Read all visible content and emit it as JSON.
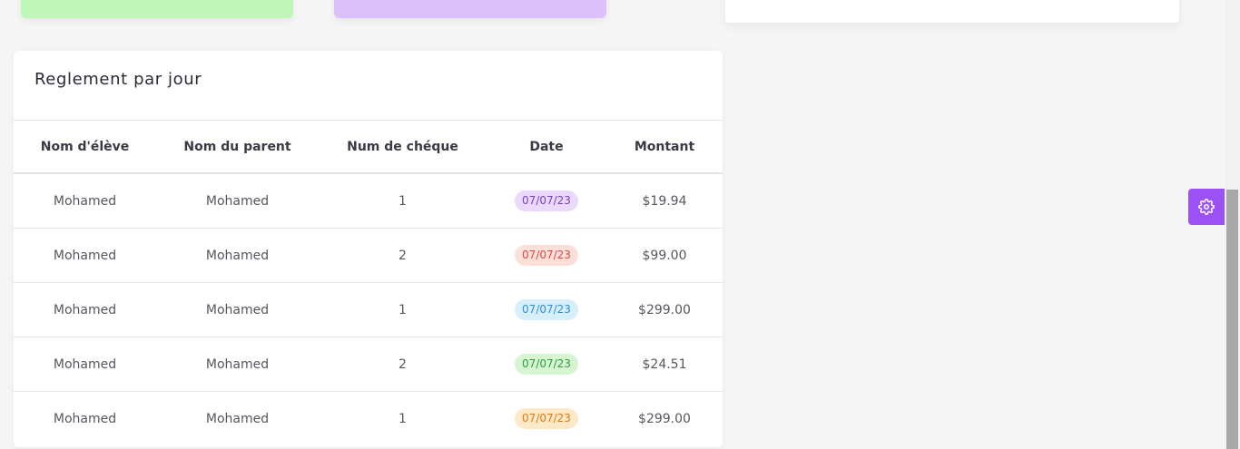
{
  "card": {
    "title": "Reglement par jour"
  },
  "table": {
    "headers": [
      "Nom d'élève",
      "Nom du parent",
      "Num de chéque",
      "Date",
      "Montant"
    ],
    "rows": [
      {
        "eleve": "Mohamed",
        "parent": "Mohamed",
        "cheque": "1",
        "date": "07/07/23",
        "montant": "$19.94",
        "badge_color": "#7b3fc4",
        "badge_bg": "#ead9fb"
      },
      {
        "eleve": "Mohamed",
        "parent": "Mohamed",
        "cheque": "2",
        "date": "07/07/23",
        "montant": "$99.00",
        "badge_color": "#e04848",
        "badge_bg": "#fbe0da"
      },
      {
        "eleve": "Mohamed",
        "parent": "Mohamed",
        "cheque": "1",
        "date": "07/07/23",
        "montant": "$299.00",
        "badge_color": "#2f8fd8",
        "badge_bg": "#d7eefb"
      },
      {
        "eleve": "Mohamed",
        "parent": "Mohamed",
        "cheque": "2",
        "date": "07/07/23",
        "montant": "$24.51",
        "badge_color": "#2f9e3c",
        "badge_bg": "#d7f5d2"
      },
      {
        "eleve": "Mohamed",
        "parent": "Mohamed",
        "cheque": "1",
        "date": "07/07/23",
        "montant": "$299.00",
        "badge_color": "#e07a10",
        "badge_bg": "#fde8c8"
      }
    ]
  },
  "colors": {
    "accent": "#9b51f5",
    "stat_green": "#bff7b9",
    "stat_purple": "#dcc0fb"
  },
  "icons": {
    "settings": "gear-icon"
  }
}
